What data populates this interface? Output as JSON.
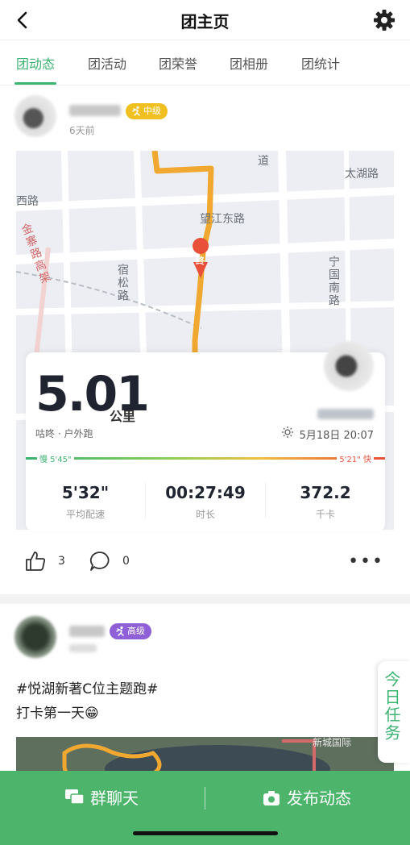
{
  "header": {
    "title": "团主页"
  },
  "tabs": [
    {
      "label": "团动态",
      "active": true
    },
    {
      "label": "团活动"
    },
    {
      "label": "团荣誉"
    },
    {
      "label": "团相册"
    },
    {
      "label": "团统计"
    }
  ],
  "post1": {
    "level_badge": "中级",
    "time": "6天前",
    "map_labels": [
      "道",
      "太湖路",
      "西路",
      "望江东路",
      "金寨路高架",
      "宿松路",
      "宁国南路",
      "终"
    ],
    "run": {
      "distance": "5.01",
      "unit": "公里",
      "subtitle": "咕咚 · 户外跑",
      "date": "5月18日 20:07",
      "pace_slow": "慢 5'45\"",
      "pace_fast": "5'21\" 快",
      "stats": [
        {
          "value": "5'32\"",
          "label": "平均配速"
        },
        {
          "value": "00:27:49",
          "label": "时长"
        },
        {
          "value": "372.2",
          "label": "千卡"
        }
      ]
    },
    "likes": "3",
    "comments": "0",
    "more": "•••"
  },
  "post2": {
    "level_badge": "高级",
    "line1": "#悦湖新著C位主题跑#",
    "line2": "打卡第一天😁",
    "map_label": "新城国际"
  },
  "side_task": "今日任务",
  "bottom": {
    "chat": "群聊天",
    "publish": "发布动态"
  },
  "colors": {
    "accent": "#3cb371",
    "bottom_bar": "#4db46b",
    "badge_mid": "#f0c020",
    "badge_high": "#8e5fd6",
    "route": "#f0a830"
  }
}
